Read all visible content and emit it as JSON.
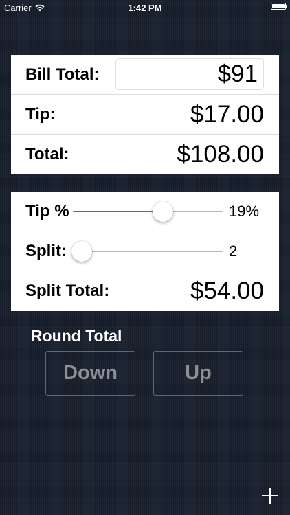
{
  "status_bar": {
    "carrier": "Carrier",
    "time": "1:42 PM"
  },
  "summary": {
    "bill_total_label": "Bill Total:",
    "bill_total_value": "$91",
    "tip_label": "Tip:",
    "tip_value": "$17.00",
    "total_label": "Total:",
    "total_value": "$108.00"
  },
  "controls": {
    "tip_percent_label": "Tip %",
    "tip_percent_value": "19%",
    "tip_slider_level": 0.6,
    "split_label": "Split:",
    "split_value": "2",
    "split_slider_level": 0.06,
    "split_total_label": "Split Total:",
    "split_total_value": "$54.00"
  },
  "round": {
    "title": "Round Total",
    "down_label": "Down",
    "up_label": "Up"
  },
  "icons": {
    "wifi": "wifi-icon",
    "battery": "battery-icon",
    "add": "plus-icon"
  },
  "colors": {
    "slider_accent": "#1a7cf4",
    "background": "#1b2230"
  }
}
